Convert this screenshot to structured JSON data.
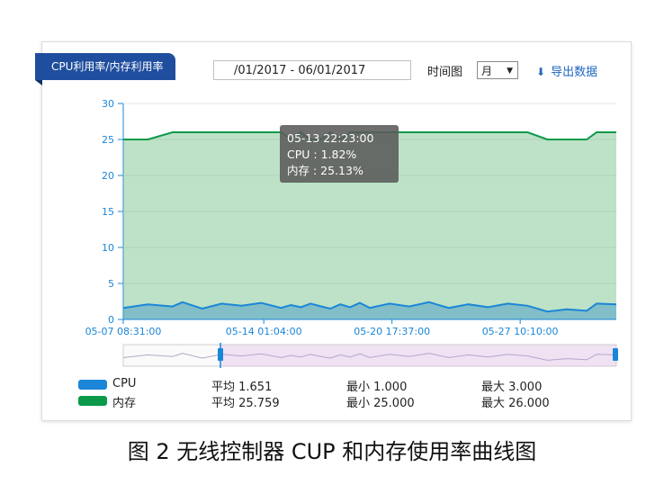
{
  "header": {
    "tab_label": "CPU利用率/内存利用率",
    "date_range_value": "/01/2017 - 06/01/2017",
    "range_type_label": "时间图",
    "range_select_value": "月",
    "export_label": "导出数据"
  },
  "tooltip": {
    "time": "05-13 22:23:00",
    "cpu": "CPU : 1.82%",
    "mem": "内存 : 25.13%"
  },
  "chart_data": {
    "type": "area",
    "ylim": [
      0,
      30
    ],
    "y_ticks": [
      "0",
      "5",
      "10",
      "15",
      "20",
      "25",
      "30"
    ],
    "x_ticks": [
      "05-07 08:31:00",
      "05-14 01:04:00",
      "05-20 17:37:00",
      "05-27 10:10:00"
    ],
    "x": [
      0,
      5,
      10,
      12,
      16,
      20,
      24,
      28,
      32,
      34,
      36,
      38,
      40,
      42,
      44,
      46,
      48,
      50,
      54,
      58,
      62,
      66,
      70,
      74,
      78,
      82,
      86,
      90,
      94,
      96,
      100
    ],
    "series": [
      {
        "name": "内存",
        "color": "#0b9a49",
        "values": [
          25,
          25,
          26,
          26,
          26,
          26,
          26,
          26,
          26,
          25,
          26,
          25,
          25,
          26,
          25,
          26,
          26,
          26,
          26,
          26,
          26,
          26,
          26,
          26,
          26,
          26,
          25,
          25,
          25,
          26,
          26
        ]
      },
      {
        "name": "CPU",
        "color": "#1b86d8",
        "values": [
          1.6,
          2.1,
          1.8,
          2.4,
          1.5,
          2.2,
          1.9,
          2.3,
          1.6,
          2.0,
          1.7,
          2.2,
          1.82,
          1.5,
          2.1,
          1.7,
          2.3,
          1.6,
          2.2,
          1.8,
          2.4,
          1.6,
          2.1,
          1.7,
          2.2,
          1.9,
          1.1,
          1.4,
          1.2,
          2.2,
          2.1
        ]
      }
    ]
  },
  "legend": [
    {
      "name": "CPU",
      "color": "#1b86d8",
      "avg": "平均 1.651",
      "min": "最小 1.000",
      "max": "最大 3.000"
    },
    {
      "name": "内存",
      "color": "#0b9a49",
      "avg": "平均 25.759",
      "min": "最小 25.000",
      "max": "最大 26.000"
    }
  ],
  "caption": "图 2  无线控制器 CUP 和内存使用率曲线图"
}
